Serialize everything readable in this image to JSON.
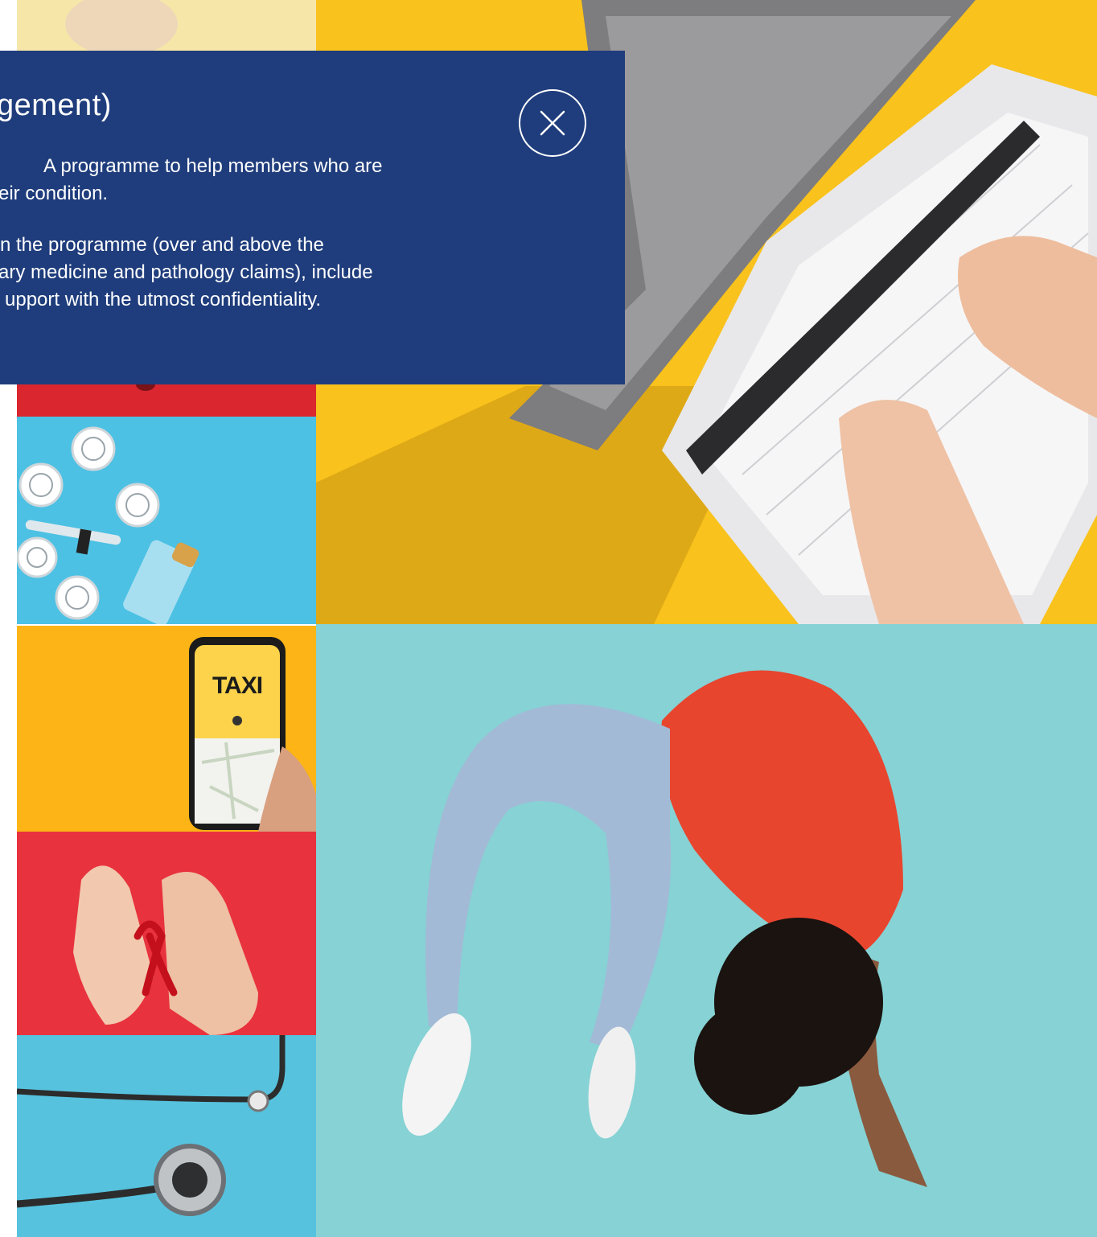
{
  "modal": {
    "title": "gement)",
    "paragraph_1_line_1": "A programme to help members who are",
    "paragraph_1_line_2": "eir condition.",
    "paragraph_2_line_1": "n the programme (over and above the",
    "paragraph_2_line_2": "ary medicine and pathology claims), include",
    "paragraph_2_line_3": "upport with the utmost confidentiality.",
    "close_icon": "close-icon",
    "background_color": "#1f3d7c"
  },
  "tiles": {
    "taxi_phone_text": "TAXI"
  },
  "colors": {
    "yellow": "#f9c21c",
    "amber": "#fcb416",
    "red": "#e8323e",
    "sky": "#4cc1e4",
    "teal": "#86d2d4"
  }
}
